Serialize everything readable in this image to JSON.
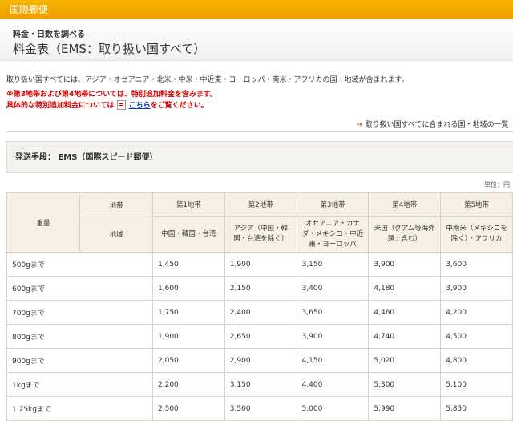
{
  "topbar": {
    "label": "国際郵便"
  },
  "header": {
    "subtitle": "料金・日数を調べる",
    "title": "料金表（EMS：取り扱い国すべて）"
  },
  "description": "取り扱い国すべてには、アジア・オセアニア・北米・中米・中近東・ヨーロッパ・南米・アフリカの国・地域が含まれます。",
  "notice": {
    "line1": "※第3地帯および第4地帯については、特別追加料金を含みます。",
    "line2_before": "具体的な特別追加料金については",
    "line2_link": "こちら",
    "line2_after": "をご覧ください。"
  },
  "countries_link": "取り扱い国すべてに含まれる国・地域の一覧",
  "method": "発送手段：  EMS（国際スピード郵便）",
  "unit": "単位：円",
  "table": {
    "weight_header": "重量",
    "zone_header": "地帯",
    "region_header": "地域",
    "zones": [
      {
        "name": "第1地帯",
        "region": "中国・韓国・台湾"
      },
      {
        "name": "第2地帯",
        "region": "アジア（中国・韓国・台湾を除く）"
      },
      {
        "name": "第3地帯",
        "region": "オセアニア・カナダ・メキシコ・中近東・ヨーロッパ"
      },
      {
        "name": "第4地帯",
        "region": "米国（グアム等海外領土含む）"
      },
      {
        "name": "第5地帯",
        "region": "中南米（メキシコを除く）・アフリカ"
      }
    ],
    "rows": [
      {
        "weight": "500gまで",
        "prices": [
          "1,450",
          "1,900",
          "3,150",
          "3,900",
          "3,600"
        ]
      },
      {
        "weight": "600gまで",
        "prices": [
          "1,600",
          "2,150",
          "3,400",
          "4,180",
          "3,900"
        ]
      },
      {
        "weight": "700gまで",
        "prices": [
          "1,750",
          "2,400",
          "3,650",
          "4,460",
          "4,200"
        ]
      },
      {
        "weight": "800gまで",
        "prices": [
          "1,900",
          "2,650",
          "3,900",
          "4,740",
          "4,500"
        ]
      },
      {
        "weight": "900gまで",
        "prices": [
          "2,050",
          "2,900",
          "4,150",
          "5,020",
          "4,800"
        ]
      },
      {
        "weight": "1kgまで",
        "prices": [
          "2,200",
          "3,150",
          "4,400",
          "5,300",
          "5,100"
        ]
      },
      {
        "weight": "1.25kgまで",
        "prices": [
          "2,500",
          "3,500",
          "5,000",
          "5,990",
          "5,850"
        ]
      }
    ]
  }
}
